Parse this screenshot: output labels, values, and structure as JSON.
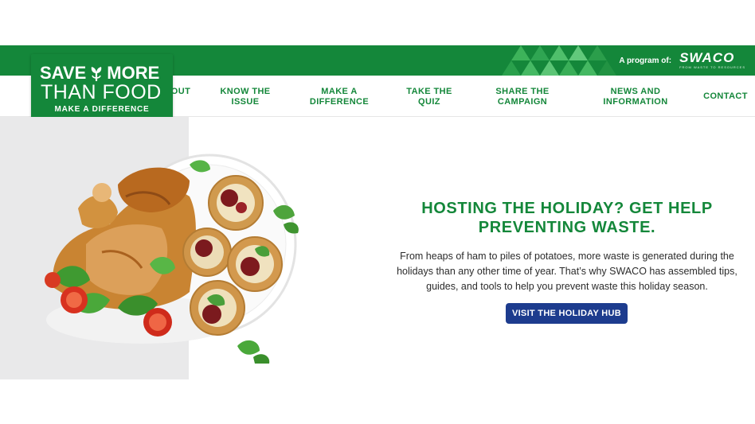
{
  "program": {
    "label": "A program of:",
    "org_name": "SWACO",
    "org_tagline": "FROM WASTE TO RESOURCES"
  },
  "logo": {
    "line1_left": "SAVE",
    "line1_right": "MORE",
    "line2": "THAN FOOD",
    "line3": "MAKE A DIFFERENCE",
    "icon": "sprout-icon"
  },
  "nav": {
    "items": [
      {
        "label": "ABOUT",
        "visible_label": "OUT"
      },
      {
        "label": "KNOW THE\nISSUE"
      },
      {
        "label": "MAKE A\nDIFFERENCE"
      },
      {
        "label": "TAKE THE\nQUIZ"
      },
      {
        "label": "SHARE THE\nCAMPAIGN"
      },
      {
        "label": "NEWS AND\nINFORMATION"
      },
      {
        "label": "CONTACT"
      }
    ]
  },
  "hero": {
    "headline": "HOSTING THE HOLIDAY? GET HELP PREVENTING WASTE.",
    "body": "From heaps of ham to piles of potatoes, more waste is generated during the holidays than any other time of year. That’s why SWACO has assembled tips, guides, and tools to help you prevent waste this holiday season.",
    "cta_label": "VISIT THE HOLIDAY HUB",
    "image": "roast-chicken-and-crackers-photo"
  },
  "colors": {
    "brand_green": "#14873a",
    "cta_blue": "#1d3c8e",
    "panel_gray": "#e9e9ea"
  }
}
